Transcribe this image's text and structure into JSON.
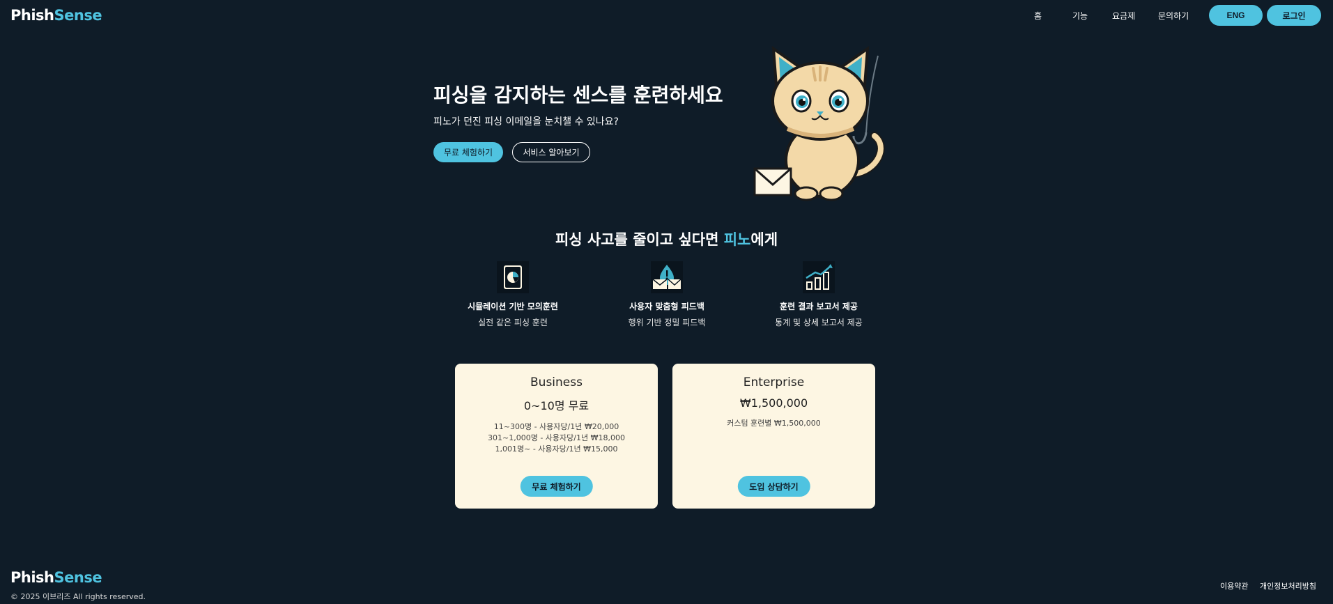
{
  "header": {
    "logo_part1": "Phish",
    "logo_part2": "Sense",
    "nav": [
      "홈",
      "기능",
      "요금제",
      "문의하기"
    ],
    "lang_button": "ENG",
    "login_button": "로그인"
  },
  "hero": {
    "title": "피싱을 감지하는 센스를 훈련하세요",
    "subtitle": "피노가 던진 피싱 이메일을 눈치챌 수 있나요?",
    "primary_button": "무료 체험하기",
    "secondary_button": "서비스 알아보기"
  },
  "features_section": {
    "title_part1": "피싱 사고를 줄이고 싶다면 ",
    "title_accent": "피노",
    "title_part2": "에게",
    "features": [
      {
        "icon": "report-chart-icon",
        "title": "시뮬레이션 기반 모의훈련",
        "desc": "실전 같은 피싱 훈련"
      },
      {
        "icon": "alert-mail-icon",
        "title": "사용자 맞춤형 피드백",
        "desc": "행위 기반 정밀 피드백"
      },
      {
        "icon": "growth-chart-icon",
        "title": "훈련 결과 보고서 제공",
        "desc": "통계 및 상세 보고서 제공"
      }
    ]
  },
  "pricing": [
    {
      "name": "Business",
      "price": "0~10명 무료",
      "lines": [
        "11~300명 - 사용자당/1년 ₩20,000",
        "301~1,000명 - 사용자당/1년 ₩18,000",
        "1,001명~ - 사용자당/1년 ₩15,000"
      ],
      "button": "무료 체험하기"
    },
    {
      "name": "Enterprise",
      "price": "₩1,500,000",
      "lines": [
        "커스텀 훈련별 ₩1,500,000"
      ],
      "button": "도입 상담하기"
    }
  ],
  "footer": {
    "logo_part1": "Phish",
    "logo_part2": "Sense",
    "copyright": "© 2025 이브리즈 All rights reserved.",
    "links": [
      "이용약관",
      "개인정보처리방침"
    ]
  },
  "colors": {
    "background": "#0f1c28",
    "accent": "#4fc3e0",
    "card": "#fdf6e3"
  }
}
